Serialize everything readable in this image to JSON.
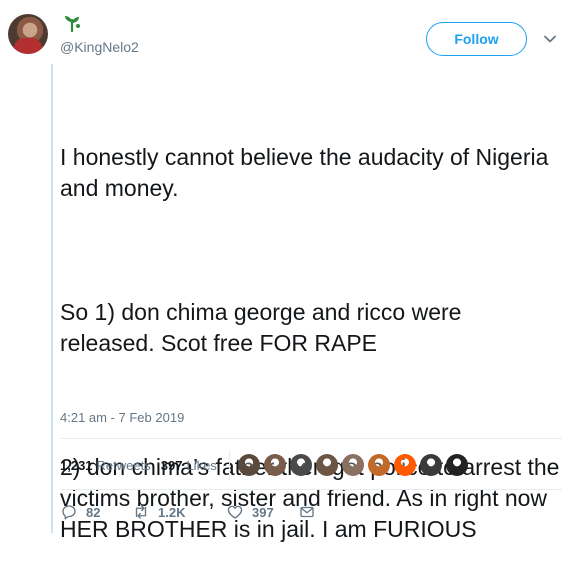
{
  "user": {
    "handle": "@KingNelo2"
  },
  "header": {
    "follow_label": "Follow"
  },
  "tweet": {
    "paragraphs": [
      "I honestly cannot believe the audacity of Nigeria and money.",
      "So 1) don chima george and ricco were released. Scot free FOR RAPE",
      "2) don chima’s father then got police to arrest the victims brother, sister and friend. As in right now HER BROTHER is in jail. I am FURIOUS"
    ],
    "timestamp": "4:21 am - 7 Feb 2019"
  },
  "stats": {
    "retweets_count": "1,231",
    "retweets_label": "Retweets",
    "likes_count": "397",
    "likes_label": "Likes"
  },
  "likers": [
    {
      "name": "liker-avatar-1",
      "color": "#5a4a3e"
    },
    {
      "name": "liker-avatar-2",
      "color": "#7a5c4a"
    },
    {
      "name": "liker-avatar-3",
      "color": "#4a4a4a"
    },
    {
      "name": "liker-avatar-4",
      "color": "#6b5545"
    },
    {
      "name": "liker-avatar-5",
      "color": "#8a7060"
    },
    {
      "name": "liker-avatar-6",
      "color": "#c26a2a"
    },
    {
      "name": "liker-avatar-7",
      "color": "#ff5a00"
    },
    {
      "name": "liker-avatar-8",
      "color": "#3a3a3a"
    },
    {
      "name": "liker-avatar-9",
      "color": "#222222"
    }
  ],
  "actions": {
    "replies": "82",
    "retweets": "1.2K",
    "likes": "397"
  },
  "icons": {
    "reply": "reply-icon",
    "retweet": "retweet-icon",
    "like": "heart-icon",
    "dm": "envelope-icon",
    "menu": "chevron-down-icon",
    "badge": "sprout-icon"
  },
  "colors": {
    "accent": "#1da1f2",
    "muted": "#657786",
    "thread_line": "#c7e3f6"
  }
}
